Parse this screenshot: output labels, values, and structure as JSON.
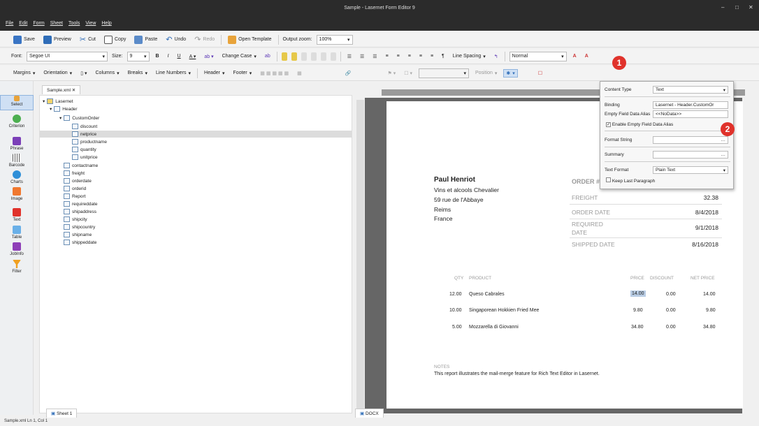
{
  "window": {
    "title": "Sample - Lasernet Form Editor 9"
  },
  "menu": [
    "File",
    "Edit",
    "Form",
    "Sheet",
    "Tools",
    "View",
    "Help"
  ],
  "toolbar1": {
    "save": "Save",
    "preview": "Preview",
    "cut": "Cut",
    "copy": "Copy",
    "paste": "Paste",
    "undo": "Undo",
    "redo": "Redo",
    "open_template": "Open Template",
    "zoom_label": "Output zoom:",
    "zoom_value": "100%"
  },
  "toolbar2": {
    "font_label": "Font:",
    "font_value": "Segoe UI",
    "size_label": "Size:",
    "size_value": "9",
    "bold": "B",
    "italic": "I",
    "underline": "U",
    "change_case": "Change Case",
    "line_spacing": "Line Spacing",
    "style_value": "Normal"
  },
  "toolbar3": {
    "margins": "Margins",
    "orientation": "Orientation",
    "columns": "Columns",
    "breaks": "Breaks",
    "line_numbers": "Line Numbers",
    "header": "Header",
    "footer": "Footer",
    "position": "Position"
  },
  "tools": [
    "Select",
    "Criterion",
    "Phrase",
    "Barcode",
    "Charts",
    "Image",
    "Text",
    "Table",
    "JobInfo",
    "Filter"
  ],
  "tree": {
    "tab": "Sample.xml",
    "nodes": [
      "Lasernet",
      "Header",
      "CustomOrder",
      "discount",
      "netprice",
      "productname",
      "quantity",
      "unitprice",
      "contactname",
      "freight",
      "orderdate",
      "orderid",
      "Report",
      "requireddate",
      "shipaddress",
      "shipcity",
      "shipcountry",
      "shipname",
      "shippeddate"
    ],
    "sheet_tab": "Sheet 1",
    "docx_tab": "DOCX"
  },
  "document": {
    "name": "Paul Henriot",
    "address": [
      "Vins et alcools Chevalier",
      "59 rue de l'Abbaye",
      "Reims",
      "France"
    ],
    "order_label": "ORDER #",
    "fields": [
      {
        "label": "FREIGHT",
        "value": "32.38"
      },
      {
        "label": "ORDER DATE",
        "value": "8/4/2018"
      },
      {
        "label": "REQUIRED",
        "label2": "DATE",
        "value": "9/1/2018"
      },
      {
        "label": "SHIPPED DATE",
        "value": "8/16/2018"
      }
    ],
    "table_headers": [
      "QTY",
      "PRODUCT",
      "PRICE",
      "DISCOUNT",
      "NET PRICE"
    ],
    "rows": [
      {
        "qty": "12.00",
        "product": "Queso Cabrales",
        "price": "14.00",
        "discount": "0.00",
        "net": "14.00"
      },
      {
        "qty": "10.00",
        "product": "Singaporean Hokkien Fried Mee",
        "price": "9.80",
        "discount": "0.00",
        "net": "9.80"
      },
      {
        "qty": "5.00",
        "product": "Mozzarella di Giovanni",
        "price": "34.80",
        "discount": "0.00",
        "net": "34.80"
      }
    ],
    "notes_label": "NOTES",
    "notes_text": "This report illustrates the mail-merge feature for Rich Text Editor in Lasernet."
  },
  "popup": {
    "content_type_label": "Content Type",
    "content_type_value": "Text",
    "binding_label": "Binding",
    "binding_value": "Lasernet - Header.CustomOr",
    "alias_label": "Empty Field Data Alias",
    "alias_value": "<<NoData>>",
    "enable_alias": "Enable Empty Field Data Alias",
    "format_string_label": "Format String",
    "summary_label": "Summary",
    "text_format_label": "Text Format",
    "text_format_value": "Plain Text",
    "keep_last": "Keep Last Paragraph"
  },
  "badges": [
    "1",
    "2"
  ],
  "status": {
    "text": "Sample.xml  Ln 1, Col 1"
  },
  "colors": {
    "title_bg": "#2b2b2b",
    "badge": "#e0322b",
    "select_highlight": "#dce3ee"
  }
}
